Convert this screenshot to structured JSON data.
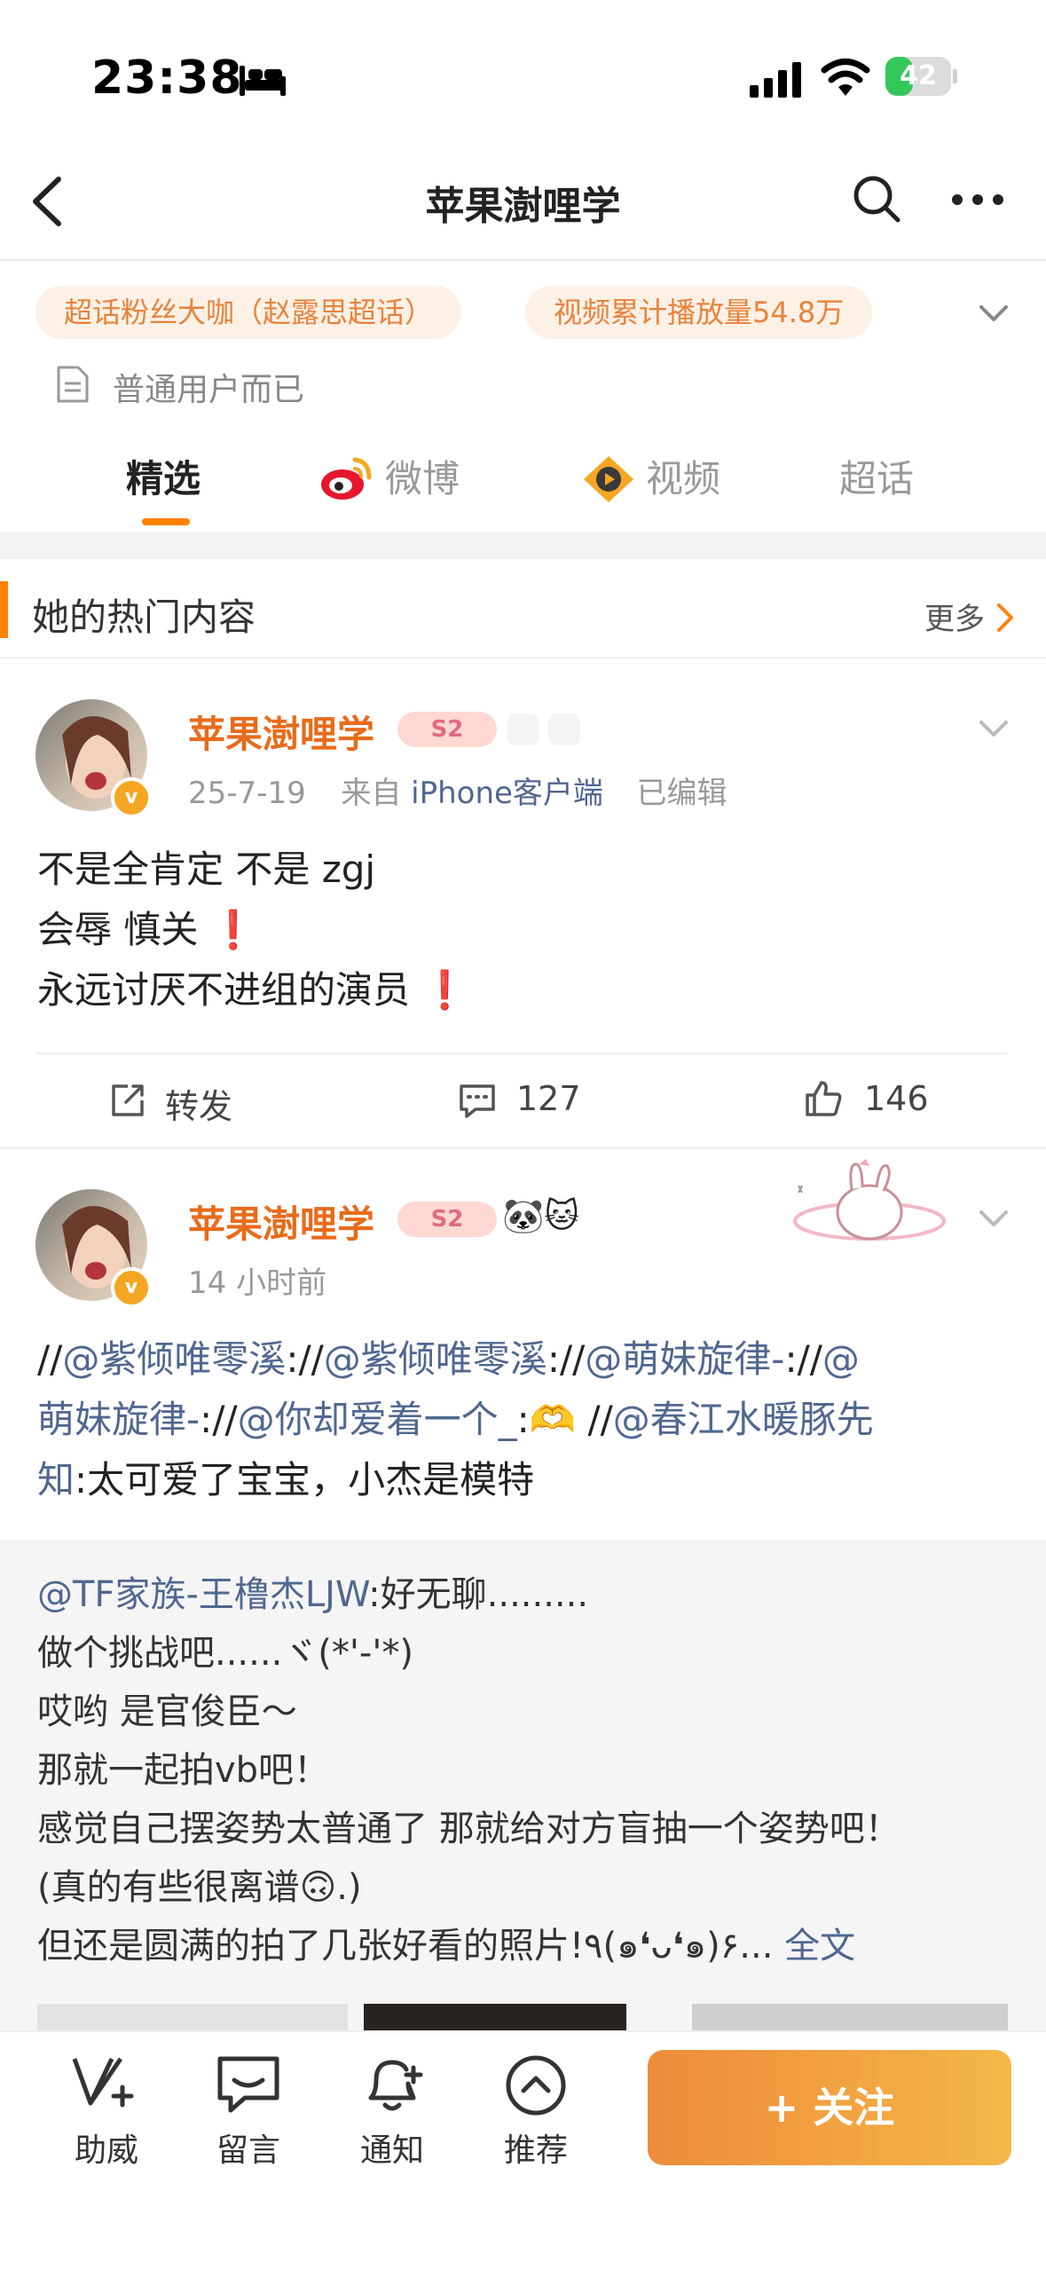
{
  "status_bar": {
    "time": "23:38",
    "battery_percent": 42,
    "battery_label": "42"
  },
  "nav": {
    "title": "苹果澍哩学"
  },
  "badges": {
    "fan_badge": "超话粉丝大咖（赵露思超话）",
    "views_badge": "视频累计播放量54.8万"
  },
  "profile": {
    "description": "普通用户而已"
  },
  "tabs": [
    {
      "label": "精选",
      "active": true
    },
    {
      "label": "微博",
      "active": false
    },
    {
      "label": "视频",
      "active": false
    },
    {
      "label": "超话",
      "active": false
    }
  ],
  "section": {
    "title": "她的热门内容",
    "more": "更多"
  },
  "posts": [
    {
      "username": "苹果澍哩学",
      "level": "S2",
      "date": "25-7-19",
      "from_prefix": "来自",
      "source": "iPhone客户端",
      "edited": "已编辑",
      "lines": [
        "不是全肯定 不是 zgj",
        "会辱 慎关",
        "永远讨厌不进组的演员"
      ],
      "repost_label": "转发",
      "comments": "127",
      "likes": "146"
    },
    {
      "username": "苹果澍哩学",
      "level": "S2",
      "time": "14 小时前",
      "line1_parts": [
        "//",
        "@紫倾唯零溪",
        ":",
        "//",
        "@紫倾唯零溪",
        ":",
        "//",
        "@萌妹旋律-",
        ":",
        "//",
        "@"
      ],
      "line2_parts": [
        "萌妹旋律-",
        ":",
        "//",
        "@你却爱着一个_",
        ":",
        "🫶",
        " //",
        "@春江水暖豚先"
      ],
      "line3_parts": [
        "知",
        ":太可爱了宝宝，小杰是模特"
      ],
      "repost": {
        "mention": "@TF家族-王橹杰LJW",
        "lines": [
          ":好无聊.........",
          "做个挑战吧......ヾ(*'-'*)",
          "哎哟  是官俊臣～",
          "那就一起拍vb吧！",
          "感觉自己摆姿势太普通了  那就给对方盲抽一个姿势吧！",
          "(真的有些很离谱🙃.)",
          "但还是圆满的拍了几张好看的照片!٩(๑❛ᴗ❛๑)۶..."
        ],
        "full_text_link": "全文"
      }
    }
  ],
  "bottom_bar": {
    "items": [
      {
        "label": "助威",
        "icon": "cheer-v-icon"
      },
      {
        "label": "留言",
        "icon": "message-bubble-icon"
      },
      {
        "label": "通知",
        "icon": "bell-plus-icon"
      },
      {
        "label": "推荐",
        "icon": "chevron-up-circle-icon"
      }
    ],
    "follow_label": "+ 关注"
  },
  "colors": {
    "accent": "#ff8200",
    "username": "#e86b1b",
    "mention": "#506790",
    "follow_start": "#ee8b39",
    "follow_end": "#f4b748"
  }
}
